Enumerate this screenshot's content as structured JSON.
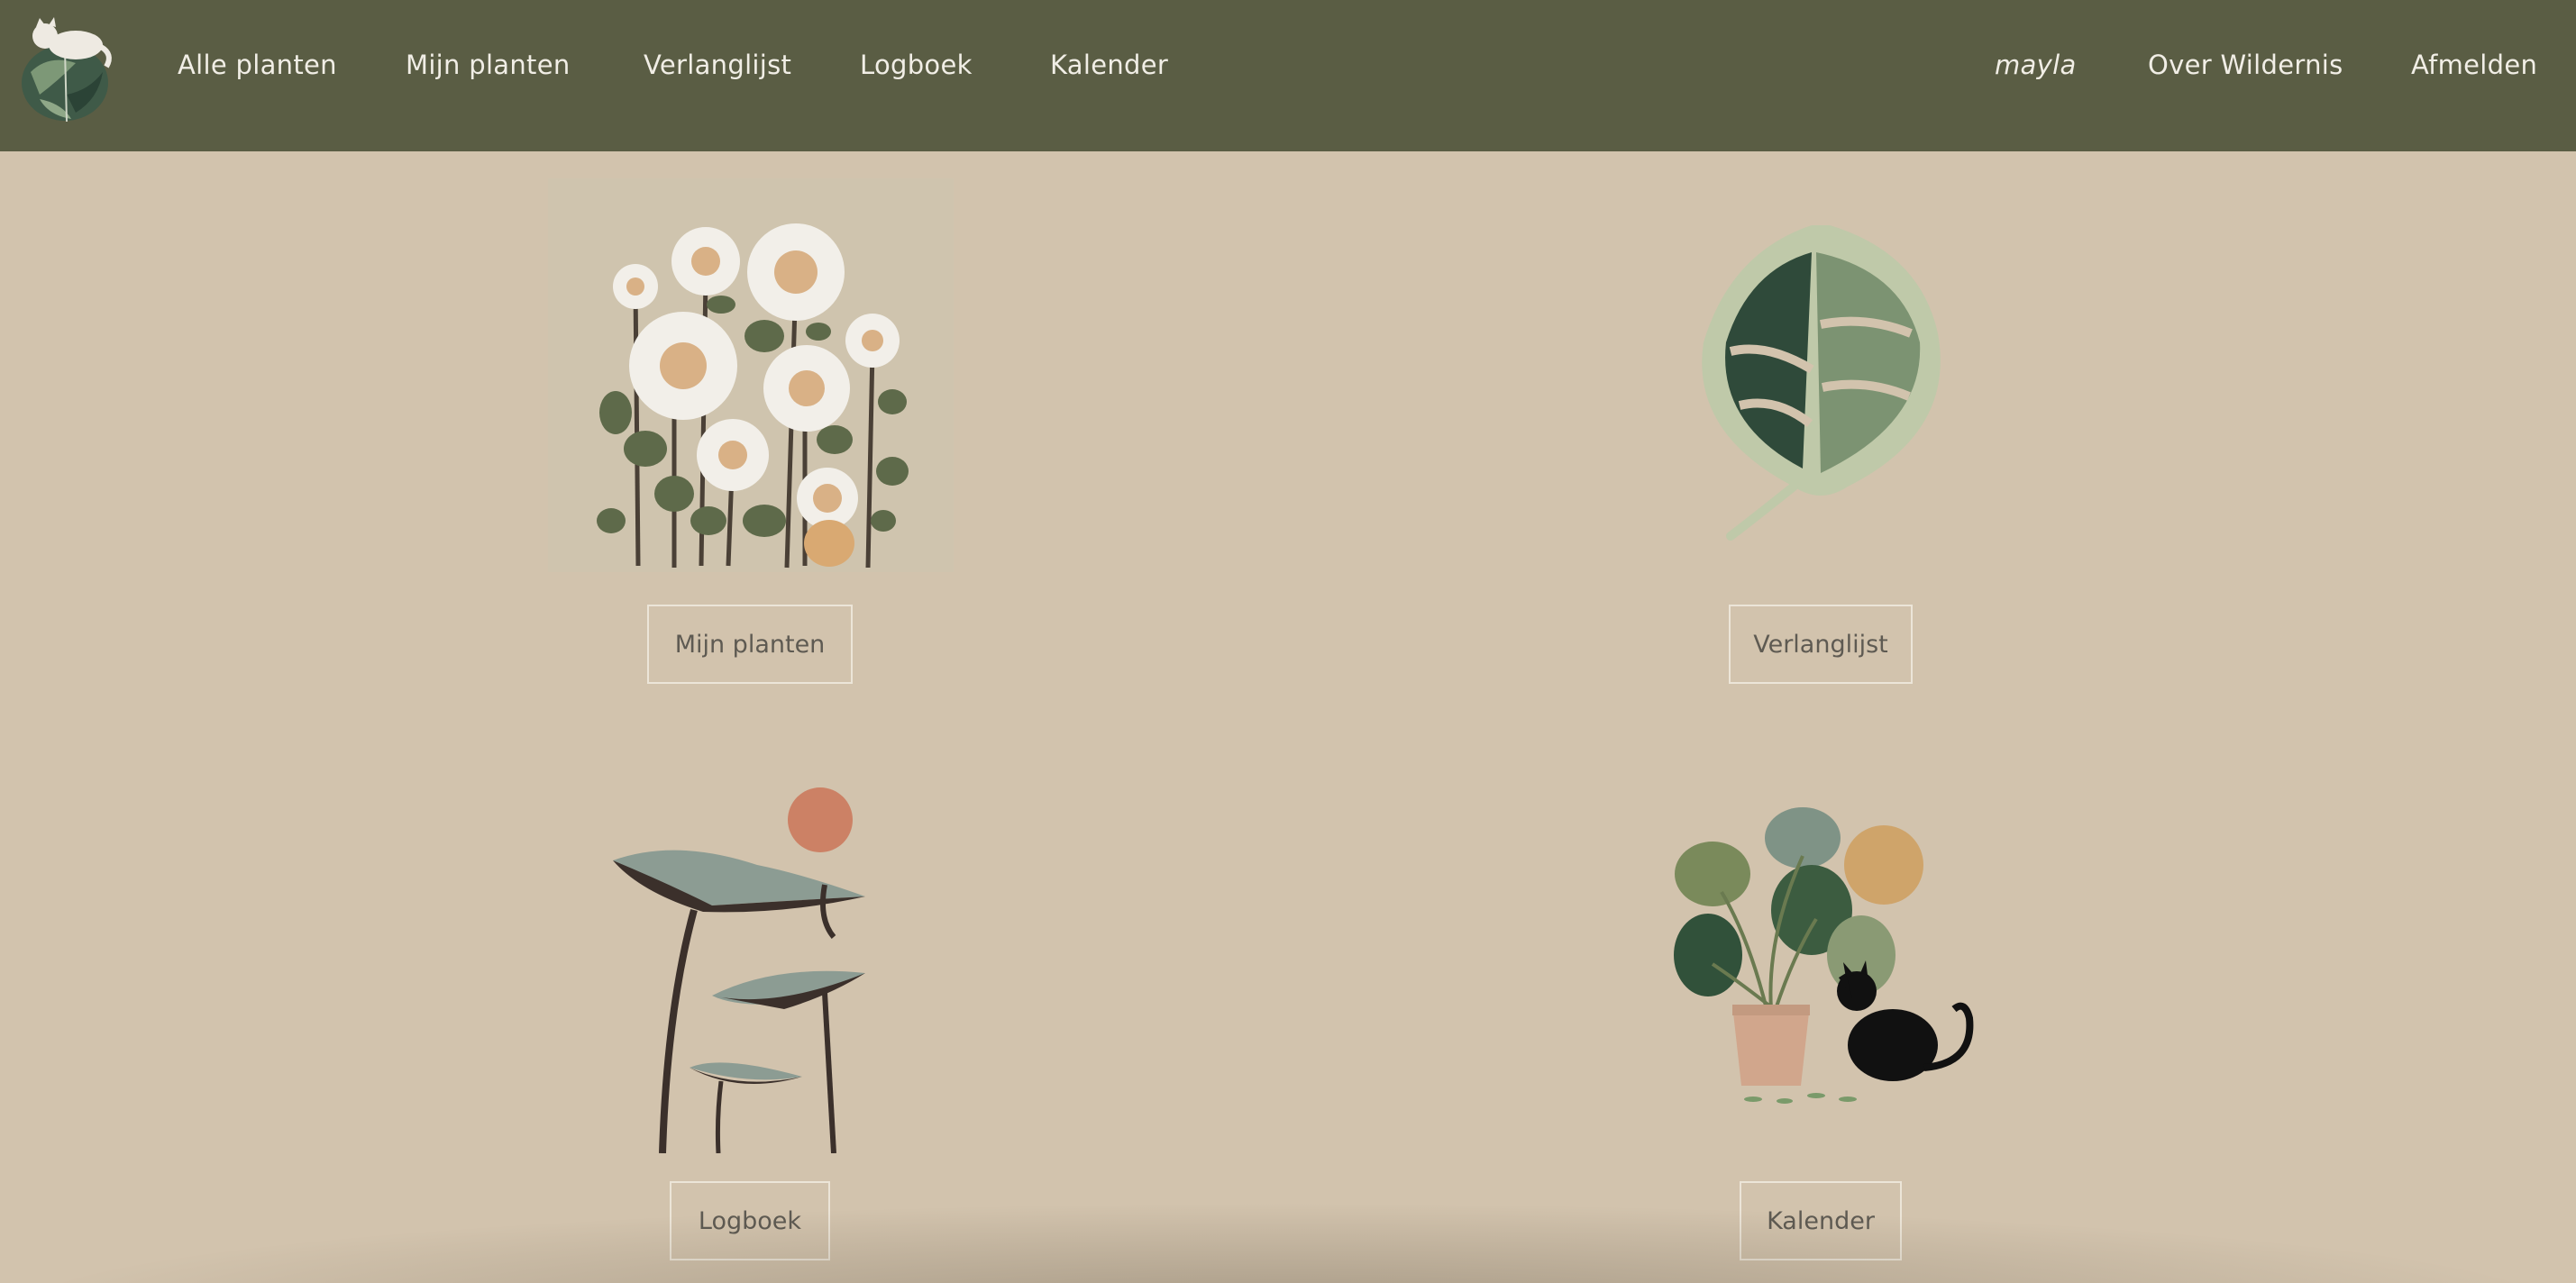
{
  "nav": {
    "left": [
      "Alle planten",
      "Mijn planten",
      "Verlanglijst",
      "Logboek",
      "Kalender"
    ],
    "user": "mayla",
    "about": "Over Wildernis",
    "logout": "Afmelden"
  },
  "tiles": {
    "mijn_planten": "Mijn planten",
    "verlanglijst": "Verlanglijst",
    "logboek": "Logboek",
    "kalender": "Kalender"
  },
  "colors": {
    "header_bg": "#5a5d44",
    "page_bg": "#d2c3ad",
    "nav_text": "#f1eee6",
    "button_border": "#ece5d8"
  }
}
